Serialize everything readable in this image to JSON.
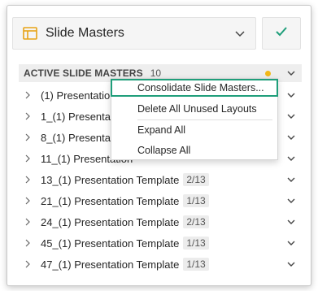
{
  "header": {
    "title": "Slide Masters",
    "icon": "slide-layout-icon",
    "accent": "#e8a317",
    "confirm_icon": "check-icon",
    "confirm_color": "#1f9e7a"
  },
  "section": {
    "label": "ACTIVE SLIDE MASTERS",
    "count": "10",
    "status_dot_color": "#f2b818"
  },
  "masters": [
    {
      "name": "(1) Presentation T",
      "badge": ""
    },
    {
      "name": "1_(1) Presentation",
      "badge": ""
    },
    {
      "name": "8_(1) Presentation",
      "badge": ""
    },
    {
      "name": "11_(1) Presentation",
      "badge": ""
    },
    {
      "name": "13_(1) Presentation Template",
      "badge": "2/13"
    },
    {
      "name": "21_(1) Presentation Template",
      "badge": "1/13"
    },
    {
      "name": "24_(1) Presentation Template",
      "badge": "2/13"
    },
    {
      "name": "45_(1) Presentation Template",
      "badge": "1/13"
    },
    {
      "name": "47_(1) Presentation Template",
      "badge": "1/13"
    }
  ],
  "context_menu": {
    "items": [
      "Consolidate Slide Masters...",
      "Delete All Unused Layouts",
      "Expand All",
      "Collapse All"
    ],
    "focused_index": 0,
    "focus_color": "#1f9e7a"
  }
}
